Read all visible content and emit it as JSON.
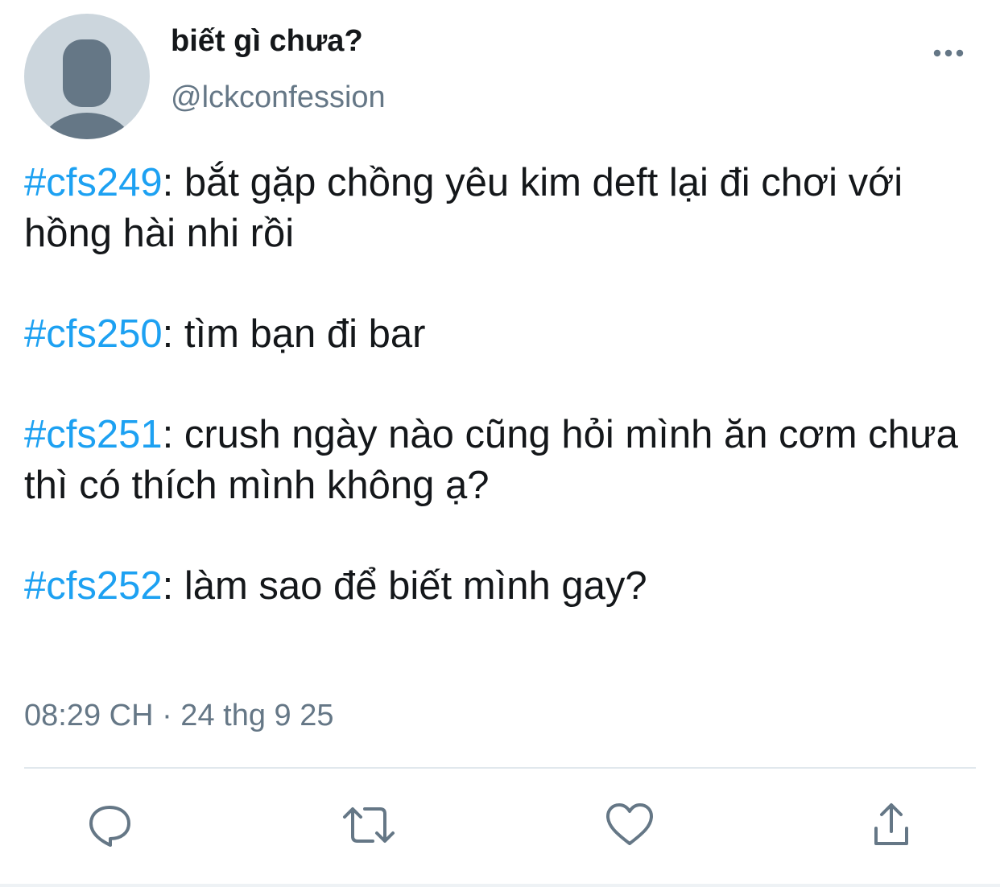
{
  "author": {
    "display_name": "biết gì chưa?",
    "handle": "@lckconfession",
    "avatar_icon": "default-profile-icon",
    "more_icon": "more-dots-icon"
  },
  "tweet": {
    "paragraphs": [
      {
        "hashtag": "#cfs249",
        "text": ": bắt gặp chồng yêu kim deft lại đi chơi với hồng hài nhi rồi"
      },
      {
        "hashtag": "#cfs250",
        "text": ": tìm bạn đi bar"
      },
      {
        "hashtag": "#cfs251",
        "text": ": crush ngày nào cũng hỏi mình ăn cơm chưa thì có thích mình không ạ?"
      },
      {
        "hashtag": "#cfs252",
        "text": ": làm sao để biết mình gay?"
      }
    ],
    "timestamp": "08:29 CH · 24 thg 9 25"
  },
  "actions": [
    {
      "name": "reply",
      "icon": "reply-icon"
    },
    {
      "name": "retweet",
      "icon": "retweet-icon"
    },
    {
      "name": "like",
      "icon": "heart-icon"
    },
    {
      "name": "share",
      "icon": "share-icon"
    }
  ],
  "colors": {
    "hashtag": "#1da1f2",
    "secondary_text": "#657786",
    "icon": "#657786",
    "primary_text": "#14171a"
  }
}
